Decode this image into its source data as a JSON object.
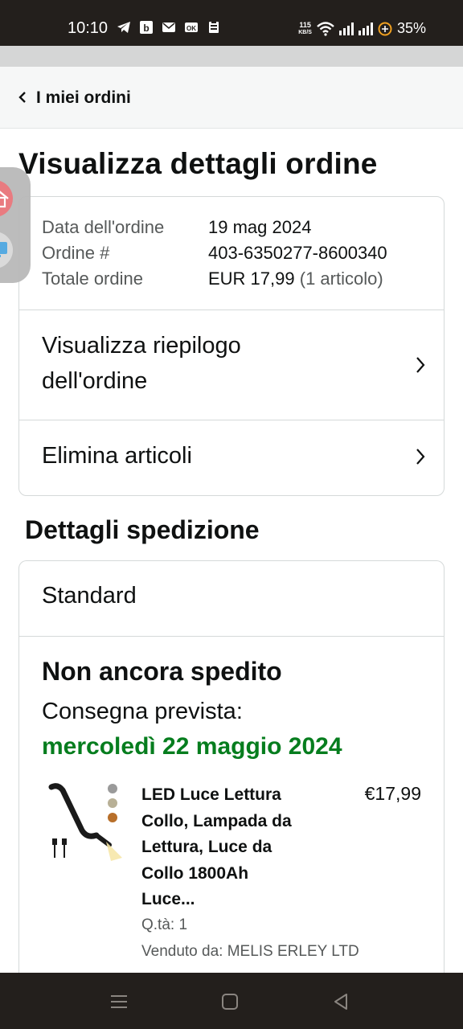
{
  "status_bar": {
    "time": "10:10",
    "speed_value": "115",
    "speed_unit": "KB/S",
    "battery": "35%"
  },
  "header": {
    "back_label": "I miei ordini"
  },
  "page": {
    "title": "Visualizza dettagli ordine"
  },
  "order": {
    "date_label": "Data dell'ordine",
    "date_value": "19 mag 2024",
    "number_label": "Ordine #",
    "number_value": "403-6350277-8600340",
    "total_label": "Totale ordine",
    "total_value": "EUR 17,99",
    "total_items": "(1 articolo)",
    "summary_link_line1": "Visualizza riepilogo",
    "summary_link_line2": "dell'ordine",
    "delete_link": "Elimina articoli"
  },
  "shipping": {
    "section_title": "Dettagli spedizione",
    "method": "Standard",
    "status": "Non ancora spedito",
    "delivery_label": "Consegna prevista:",
    "delivery_date": "mercoledì 22 maggio 2024",
    "accent_color": "#067d1e"
  },
  "product": {
    "title_lines": [
      "LED Luce Lettura",
      "Collo, Lampada da",
      "Lettura, Luce da",
      "Collo 1800Ah",
      "Luce..."
    ],
    "price": "€17,99",
    "quantity": "Q.tà: 1",
    "seller": "Venduto da: MELIS ERLEY LTD"
  },
  "icons": {
    "status_left": [
      "telegram-icon",
      "b-app-icon",
      "mail-icon",
      "ok-app-icon",
      "clipboard-icon"
    ],
    "nav": [
      "menu-icon",
      "home-icon",
      "back-icon"
    ]
  }
}
